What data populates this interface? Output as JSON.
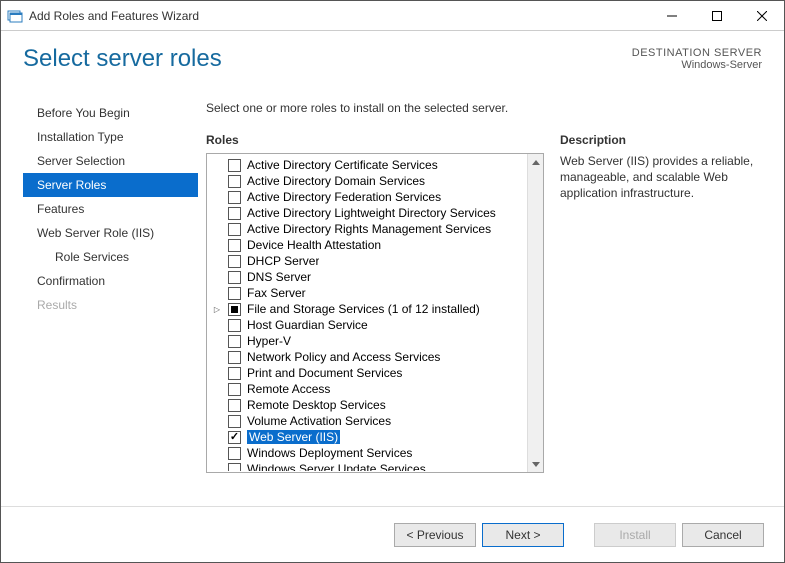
{
  "window": {
    "title": "Add Roles and Features Wizard"
  },
  "header": {
    "page_title": "Select server roles",
    "dest_label": "DESTINATION SERVER",
    "dest_value": "Windows-Server"
  },
  "sidebar": {
    "items": [
      {
        "label": "Before You Begin",
        "active": false,
        "indent": false,
        "disabled": false
      },
      {
        "label": "Installation Type",
        "active": false,
        "indent": false,
        "disabled": false
      },
      {
        "label": "Server Selection",
        "active": false,
        "indent": false,
        "disabled": false
      },
      {
        "label": "Server Roles",
        "active": true,
        "indent": false,
        "disabled": false
      },
      {
        "label": "Features",
        "active": false,
        "indent": false,
        "disabled": false
      },
      {
        "label": "Web Server Role (IIS)",
        "active": false,
        "indent": false,
        "disabled": false
      },
      {
        "label": "Role Services",
        "active": false,
        "indent": true,
        "disabled": false
      },
      {
        "label": "Confirmation",
        "active": false,
        "indent": false,
        "disabled": false
      },
      {
        "label": "Results",
        "active": false,
        "indent": false,
        "disabled": true
      }
    ]
  },
  "main": {
    "intro": "Select one or more roles to install on the selected server.",
    "roles_label": "Roles",
    "desc_label": "Description",
    "desc_text": "Web Server (IIS) provides a reliable, manageable, and scalable Web application infrastructure.",
    "roles": [
      {
        "label": "Active Directory Certificate Services",
        "state": "unchecked",
        "expander": false,
        "selected": false
      },
      {
        "label": "Active Directory Domain Services",
        "state": "unchecked",
        "expander": false,
        "selected": false
      },
      {
        "label": "Active Directory Federation Services",
        "state": "unchecked",
        "expander": false,
        "selected": false
      },
      {
        "label": "Active Directory Lightweight Directory Services",
        "state": "unchecked",
        "expander": false,
        "selected": false
      },
      {
        "label": "Active Directory Rights Management Services",
        "state": "unchecked",
        "expander": false,
        "selected": false
      },
      {
        "label": "Device Health Attestation",
        "state": "unchecked",
        "expander": false,
        "selected": false
      },
      {
        "label": "DHCP Server",
        "state": "unchecked",
        "expander": false,
        "selected": false
      },
      {
        "label": "DNS Server",
        "state": "unchecked",
        "expander": false,
        "selected": false
      },
      {
        "label": "Fax Server",
        "state": "unchecked",
        "expander": false,
        "selected": false
      },
      {
        "label": "File and Storage Services (1 of 12 installed)",
        "state": "tristate",
        "expander": true,
        "selected": false
      },
      {
        "label": "Host Guardian Service",
        "state": "unchecked",
        "expander": false,
        "selected": false
      },
      {
        "label": "Hyper-V",
        "state": "unchecked",
        "expander": false,
        "selected": false
      },
      {
        "label": "Network Policy and Access Services",
        "state": "unchecked",
        "expander": false,
        "selected": false
      },
      {
        "label": "Print and Document Services",
        "state": "unchecked",
        "expander": false,
        "selected": false
      },
      {
        "label": "Remote Access",
        "state": "unchecked",
        "expander": false,
        "selected": false
      },
      {
        "label": "Remote Desktop Services",
        "state": "unchecked",
        "expander": false,
        "selected": false
      },
      {
        "label": "Volume Activation Services",
        "state": "unchecked",
        "expander": false,
        "selected": false
      },
      {
        "label": "Web Server (IIS)",
        "state": "checked",
        "expander": false,
        "selected": true
      },
      {
        "label": "Windows Deployment Services",
        "state": "unchecked",
        "expander": false,
        "selected": false
      },
      {
        "label": "Windows Server Update Services",
        "state": "unchecked",
        "expander": false,
        "selected": false
      }
    ]
  },
  "footer": {
    "previous": "< Previous",
    "next": "Next >",
    "install": "Install",
    "cancel": "Cancel"
  }
}
